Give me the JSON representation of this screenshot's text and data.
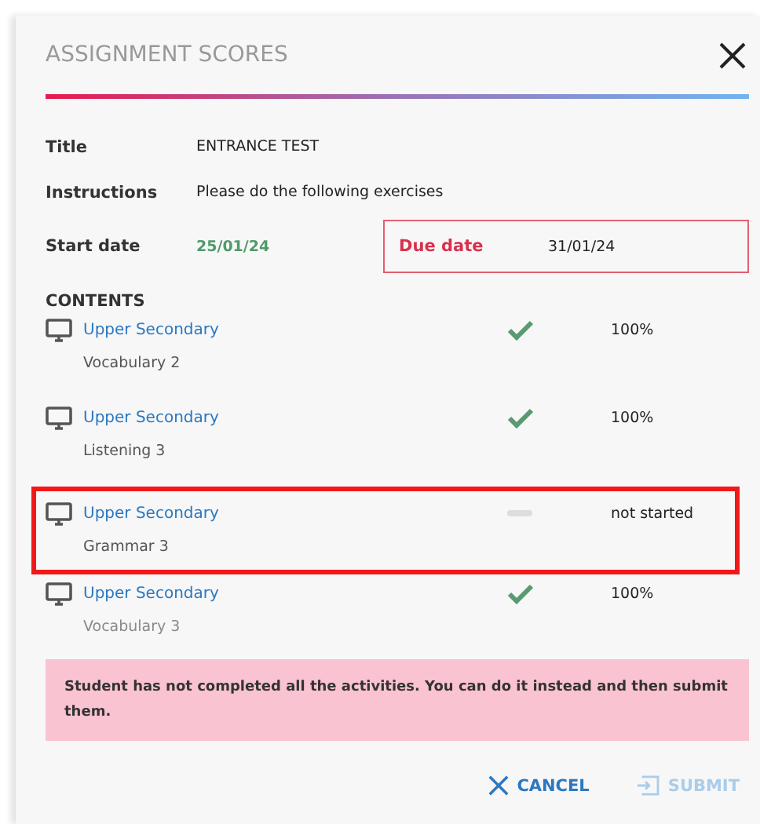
{
  "dialog": {
    "title": "ASSIGNMENT SCORES"
  },
  "details": [
    {
      "label": "Title",
      "value": "ENTRANCE TEST"
    },
    {
      "label": "Instructions",
      "value": "Please do the following exercises"
    }
  ],
  "start_date": {
    "label": "Start date",
    "value": "25/01/24"
  },
  "due_date": {
    "label": "Due date",
    "value": "31/01/24"
  },
  "contents": {
    "heading": "CONTENTS",
    "items": [
      {
        "title": "Upper Secondary",
        "subtitle": "Vocabulary 2",
        "completed": true,
        "score": "100%",
        "highlighted": false
      },
      {
        "title": "Upper Secondary",
        "subtitle": "Listening 3",
        "completed": true,
        "score": "100%",
        "highlighted": false
      },
      {
        "title": "Upper Secondary",
        "subtitle": "Grammar 3",
        "completed": false,
        "score": "not started",
        "highlighted": true
      },
      {
        "title": "Upper Secondary",
        "subtitle": "Vocabulary 3",
        "completed": true,
        "score": "100%",
        "highlighted": false
      }
    ]
  },
  "alert": "Student has not completed all the activities. You can do it instead and then submit them.",
  "buttons": [
    {
      "label": "CANCEL",
      "kind": "cancel",
      "disabled": false
    },
    {
      "label": "SUBMIT",
      "kind": "submit",
      "disabled": true
    }
  ]
}
